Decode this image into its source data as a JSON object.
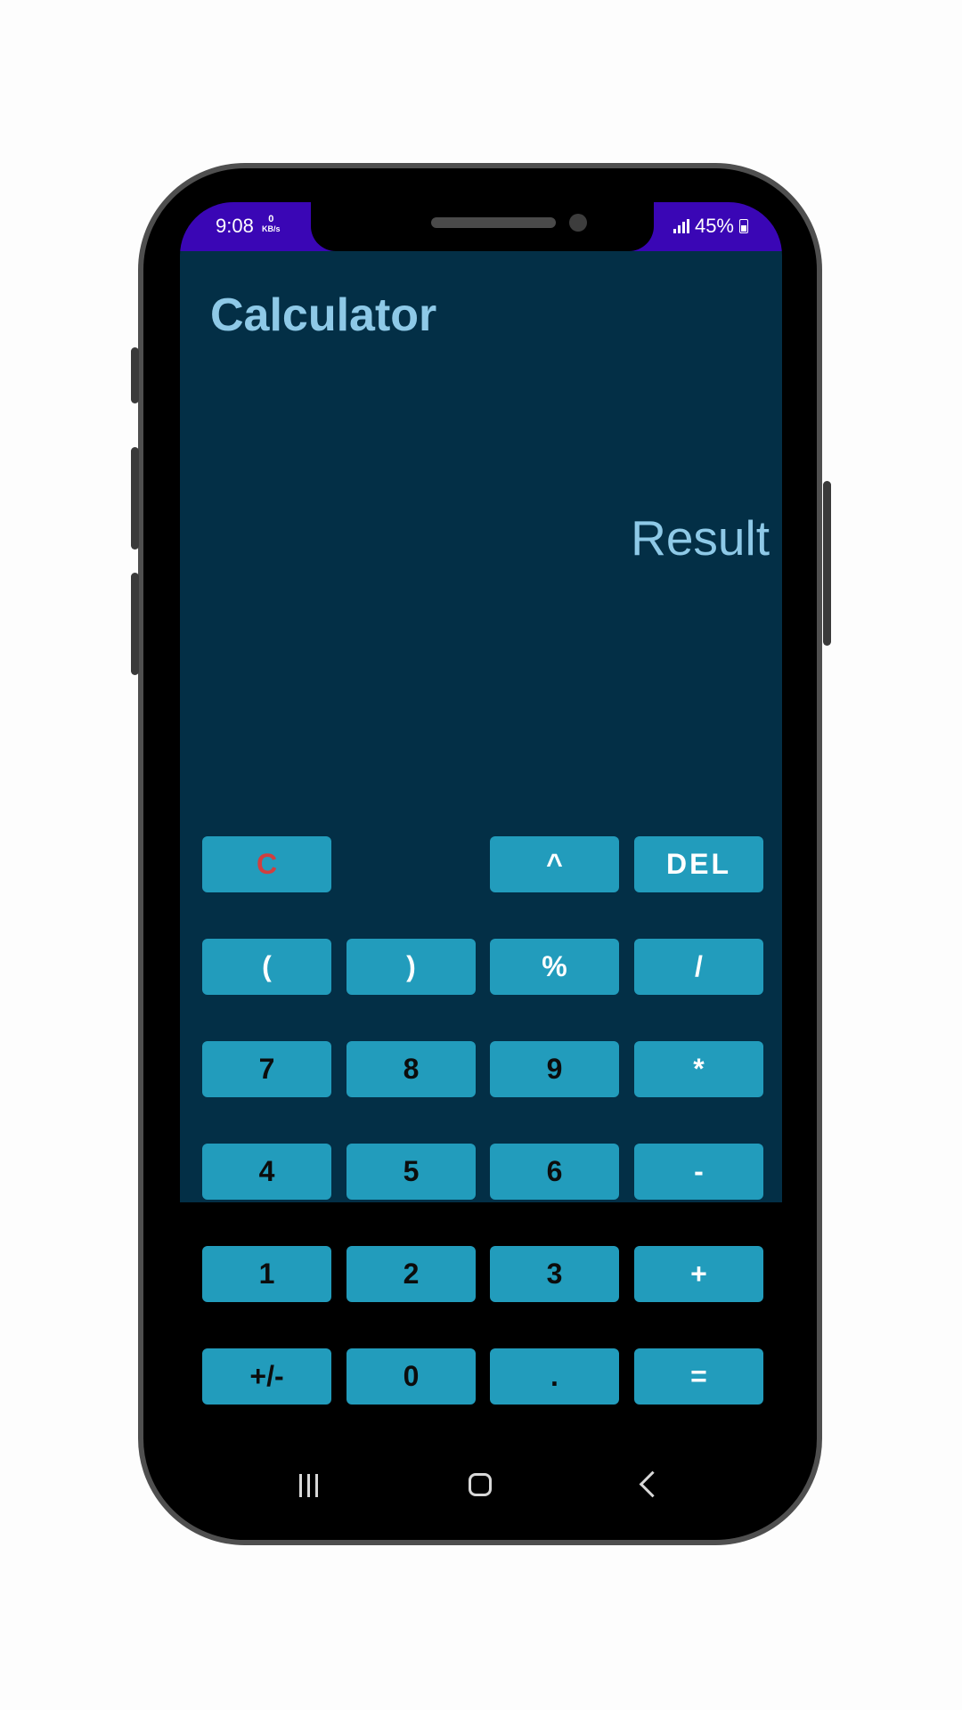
{
  "status_bar": {
    "time": "9:08",
    "net_speed_value": "0",
    "net_speed_unit": "KB/s",
    "battery": "45%",
    "icons": [
      "signal-icon",
      "battery-icon"
    ]
  },
  "app": {
    "title": "Calculator",
    "result": "Result",
    "background": "#032f46",
    "key_color": "#229cbc",
    "accent_text": "#8ec9e7"
  },
  "keys": {
    "clear": "C",
    "power": "^",
    "delete": "DEL",
    "open_paren": "(",
    "close_paren": ")",
    "percent": "%",
    "divide": "/",
    "seven": "7",
    "eight": "8",
    "nine": "9",
    "multiply": "*",
    "four": "4",
    "five": "5",
    "six": "6",
    "minus": "-",
    "one": "1",
    "two": "2",
    "three": "3",
    "plus": "+",
    "negate": "+/-",
    "zero": "0",
    "decimal": ".",
    "equals": "="
  },
  "nav_bar": {
    "icons": [
      "recents-icon",
      "home-icon",
      "back-icon"
    ]
  }
}
